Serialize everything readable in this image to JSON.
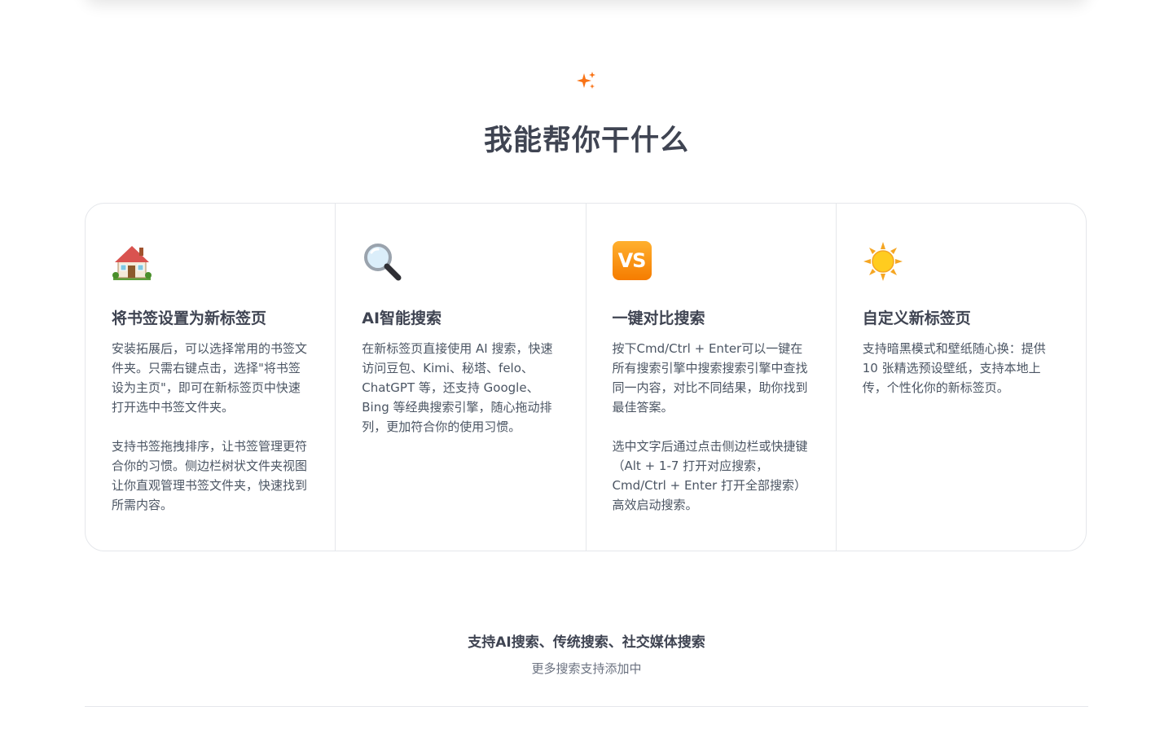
{
  "hero": {
    "icon": "sparkles-icon",
    "accent_color": "#f97316",
    "title": "我能帮你干什么"
  },
  "features": [
    {
      "icon": "house-icon",
      "title": "将书签设置为新标签页",
      "paragraphs": [
        "安装拓展后，可以选择常用的书签文件夹。只需右键点击，选择\"将书签设为主页\"，即可在新标签页中快速打开选中书签文件夹。",
        "支持书签拖拽排序，让书签管理更符合你的习惯。侧边栏树状文件夹视图让你直观管理书签文件夹，快速找到所需内容。"
      ]
    },
    {
      "icon": "magnifier-icon",
      "title": "AI智能搜索",
      "paragraphs": [
        "在新标签页直接使用 AI 搜索，快速访问豆包、Kimi、秘塔、felo、ChatGPT 等，还支持 Google、Bing 等经典搜索引擎，随心拖动排列，更加符合你的使用习惯。"
      ]
    },
    {
      "icon": "vs-icon",
      "icon_text": "VS",
      "title": "一键对比搜索",
      "paragraphs": [
        "按下Cmd/Ctrl + Enter可以一键在所有搜索引擎中搜索搜索引擎中查找同一内容，对比不同结果，助你找到最佳答案。",
        "选中文字后通过点击侧边栏或快捷键（Alt + 1-7 打开对应搜索，Cmd/Ctrl + Enter 打开全部搜索）高效启动搜索。"
      ]
    },
    {
      "icon": "sun-icon",
      "title": "自定义新标签页",
      "paragraphs": [
        "支持暗黑模式和壁纸随心换：提供 10 张精选预设壁纸，支持本地上传，个性化你的新标签页。"
      ]
    }
  ],
  "footer": {
    "title": "支持AI搜索、传统搜索、社交媒体搜索",
    "subtitle": "更多搜索支持添加中"
  }
}
